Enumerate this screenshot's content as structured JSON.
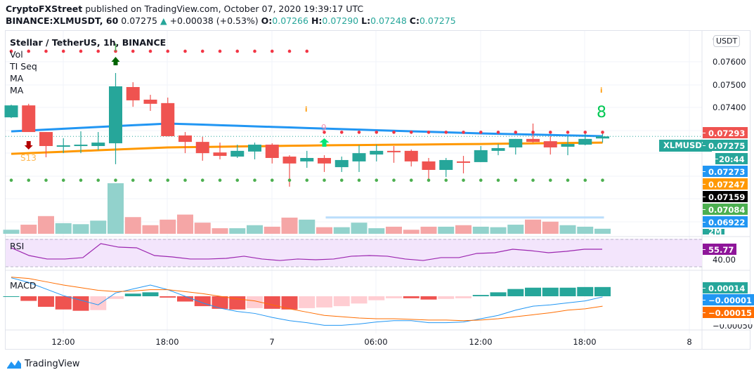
{
  "header": {
    "publisher": "CryptoFXStreet",
    "published_text": "published on TradingView.com, October 07, 2020 19:39:17 UTC",
    "symbol_full": "BINANCE:XLMUSDT, 60",
    "last": "0.07275",
    "change": "+0.00038 (+0.53%)",
    "o_label": "O:",
    "o": "0.07266",
    "h_label": "H:",
    "h": "0.07290",
    "l_label": "L:",
    "l": "0.07248",
    "c_label": "C:",
    "c": "0.07275"
  },
  "legend": {
    "title": "Stellar / TetherUS, 1h, BINANCE",
    "vol": "Vol",
    "ti_seq": "TI Seq",
    "ma1": "MA",
    "ma2": "MA",
    "rsi": "RSI",
    "macd": "MACD"
  },
  "annotations": {
    "s13": "S13",
    "nine": "9",
    "eight": "8",
    "info1": "i",
    "info2": "i"
  },
  "price_axis": {
    "currency_button": "USDT",
    "top_partial": "0",
    "ticks": [
      "0.07600",
      "0.07500",
      "0.07400"
    ],
    "symbol_tag": "XLMUSDT",
    "countdown": "20:44",
    "tags": [
      {
        "value": "0.07293",
        "color": "#ef5350"
      },
      {
        "value": "0.07275",
        "color": "#26a69a"
      },
      {
        "value": "0.07273",
        "color": "#2196f3"
      },
      {
        "value": "0.07247",
        "color": "#ff9800"
      },
      {
        "value": "0.07159",
        "color": "#000000"
      },
      {
        "value": "0.07084",
        "color": "#4caf50"
      },
      {
        "value": "0.06922",
        "color": "#2196f3"
      }
    ],
    "volume_partial": "2M"
  },
  "rsi_axis": {
    "current": "55.77",
    "current_color": "#8e1599",
    "tick": "40.00"
  },
  "macd_axis": {
    "tags": [
      {
        "value": "0.00014",
        "color": "#26a69a"
      },
      {
        "value": "−0.00001",
        "color": "#2196f3"
      },
      {
        "value": "−0.00015",
        "color": "#ff6d00"
      }
    ],
    "tick": "−0.00050"
  },
  "time_axis": [
    "12:00",
    "18:00",
    "7",
    "06:00",
    "12:00",
    "18:00",
    "8"
  ],
  "branding": {
    "name": "TradingView"
  },
  "colors": {
    "up": "#26a69a",
    "down": "#ef5350",
    "ma_fast": "#2196f3",
    "ma_slow": "#ff9800",
    "rsi": "#9c27b0",
    "macd": "#2196f3",
    "signal": "#ff6d00"
  },
  "chart_data": {
    "type": "candlestick",
    "title": "Stellar / TetherUS, 1h, BINANCE",
    "ylim": [
      0.0687,
      0.077
    ],
    "ohlc": [
      [
        0.07358,
        0.07413,
        0.07355,
        0.0741
      ],
      [
        0.0741,
        0.07417,
        0.07309,
        0.07294
      ],
      [
        0.07294,
        0.07294,
        0.07184,
        0.07233
      ],
      [
        0.0723,
        0.07267,
        0.07202,
        0.07236
      ],
      [
        0.07233,
        0.07297,
        0.07202,
        0.07239
      ],
      [
        0.07233,
        0.07294,
        0.07215,
        0.07248
      ],
      [
        0.07245,
        0.07551,
        0.07154,
        0.07493
      ],
      [
        0.0749,
        0.07511,
        0.07404,
        0.07432
      ],
      [
        0.07435,
        0.07456,
        0.07386,
        0.07417
      ],
      [
        0.0742,
        0.07444,
        0.07275,
        0.07276
      ],
      [
        0.07279,
        0.07294,
        0.07202,
        0.07251
      ],
      [
        0.07251,
        0.07273,
        0.07169,
        0.07202
      ],
      [
        0.07205,
        0.07248,
        0.07175,
        0.0719
      ],
      [
        0.07187,
        0.07239,
        0.07181,
        0.07212
      ],
      [
        0.07209,
        0.07248,
        0.07175,
        0.07239
      ],
      [
        0.07239,
        0.07245,
        0.07157,
        0.07181
      ],
      [
        0.07187,
        0.07193,
        0.07056,
        0.07157
      ],
      [
        0.07166,
        0.07212,
        0.07138,
        0.07181
      ],
      [
        0.07181,
        0.07193,
        0.0712,
        0.07157
      ],
      [
        0.07141,
        0.07187,
        0.0712,
        0.07172
      ],
      [
        0.07166,
        0.07236,
        0.0712,
        0.07202
      ],
      [
        0.07196,
        0.07239,
        0.07166,
        0.07212
      ],
      [
        0.07212,
        0.07233,
        0.0716,
        0.07206
      ],
      [
        0.07212,
        0.07218,
        0.07144,
        0.07166
      ],
      [
        0.07166,
        0.07181,
        0.07089,
        0.07129
      ],
      [
        0.07129,
        0.07181,
        0.07098,
        0.07172
      ],
      [
        0.07166,
        0.0719,
        0.07114,
        0.0716
      ],
      [
        0.07163,
        0.07233,
        0.07163,
        0.07215
      ],
      [
        0.07212,
        0.07242,
        0.07193,
        0.07224
      ],
      [
        0.07227,
        0.07264,
        0.07196,
        0.07264
      ],
      [
        0.07264,
        0.07331,
        0.07248,
        0.07251
      ],
      [
        0.07254,
        0.07276,
        0.07196,
        0.07227
      ],
      [
        0.0723,
        0.07276,
        0.07193,
        0.07242
      ],
      [
        0.07239,
        0.07294,
        0.07236,
        0.07264
      ],
      [
        0.07266,
        0.0729,
        0.07248,
        0.07275
      ]
    ],
    "volume_pct_of_max": [
      8,
      18,
      35,
      21,
      19,
      26,
      100,
      33,
      17,
      28,
      38,
      22,
      11,
      11,
      17,
      14,
      32,
      28,
      13,
      13,
      22,
      11,
      14,
      8,
      14,
      14,
      17,
      14,
      13,
      18,
      28,
      24,
      17,
      14,
      10
    ],
    "ma_fast_knots": [
      [
        0,
        0.07297
      ],
      [
        9,
        0.07331
      ],
      [
        18,
        0.07309
      ],
      [
        27,
        0.07288
      ],
      [
        34,
        0.07276
      ]
    ],
    "ma_slow_knots": [
      [
        0,
        0.07199
      ],
      [
        9,
        0.07227
      ],
      [
        18,
        0.07236
      ],
      [
        27,
        0.07242
      ],
      [
        34,
        0.07248
      ]
    ],
    "red_dots_upper": {
      "price": 0.07646,
      "from": 0,
      "to": 17
    },
    "red_dots_lower": {
      "price": 0.07293,
      "from": 18,
      "to": 34
    },
    "green_dots": {
      "price": 0.07084,
      "from": 0,
      "to": 34
    },
    "support_line": {
      "price": 0.06922,
      "from": 18,
      "to": 34
    },
    "last_price": 0.07275,
    "rsi": {
      "ylim": [
        30,
        70
      ],
      "values": [
        57.9,
        46.3,
        41.1,
        41.1,
        43.2,
        64.2,
        58.9,
        57.9,
        46.3,
        44.2,
        41.1,
        41.1,
        42.1,
        45.3,
        41.1,
        38.9,
        41.1,
        40.0,
        41.1,
        45.3,
        46.3,
        45.3,
        41.1,
        38.9,
        43.2,
        43.2,
        49.5,
        50.5,
        55.8,
        53.7,
        50.5,
        52.6,
        55.8,
        55.77
      ]
    },
    "macd": {
      "histogram": [
        0.0,
        -7e-05,
        -0.00016,
        -0.0002,
        -0.00022,
        -0.00021,
        -4e-05,
        4e-05,
        6e-05,
        -2e-05,
        -8e-05,
        -0.00015,
        -0.00019,
        -0.0002,
        -0.00018,
        -0.00019,
        -0.0002,
        -0.00018,
        -0.00017,
        -0.00015,
        -0.00011,
        -6e-05,
        -3e-05,
        -3e-05,
        -5e-05,
        -4e-05,
        -3e-05,
        2e-05,
        6e-05,
        0.00011,
        0.00013,
        0.00013,
        0.00013,
        0.00014,
        0.00014
      ],
      "macd": [
        0.00028,
        0.00021,
        0.00011,
        1e-05,
        -6e-05,
        -0.00013,
        5e-05,
        0.00011,
        0.00017,
        0.0001,
        0,
        -0.0001,
        -0.00018,
        -0.00023,
        -0.00026,
        -0.00032,
        -0.00037,
        -0.0004,
        -0.00044,
        -0.00044,
        -0.00042,
        -0.00039,
        -0.00037,
        -0.00037,
        -0.0004,
        -0.0004,
        -0.00039,
        -0.00034,
        -0.00029,
        -0.00021,
        -0.00015,
        -0.00013,
        -0.0001,
        -7e-05,
        -1e-05
      ],
      "signal": [
        0.00029,
        0.00027,
        0.00022,
        0.00017,
        0.00013,
        9e-05,
        7e-05,
        8e-05,
        0.0001,
        0.0001,
        7e-05,
        4e-05,
        0,
        -4e-05,
        -7e-05,
        -0.00013,
        -0.00019,
        -0.00024,
        -0.00029,
        -0.00031,
        -0.00033,
        -0.00034,
        -0.00034,
        -0.00035,
        -0.00036,
        -0.00036,
        -0.00037,
        -0.00036,
        -0.00034,
        -0.00031,
        -0.00028,
        -0.00025,
        -0.00021,
        -0.00019,
        -0.00015
      ]
    }
  }
}
